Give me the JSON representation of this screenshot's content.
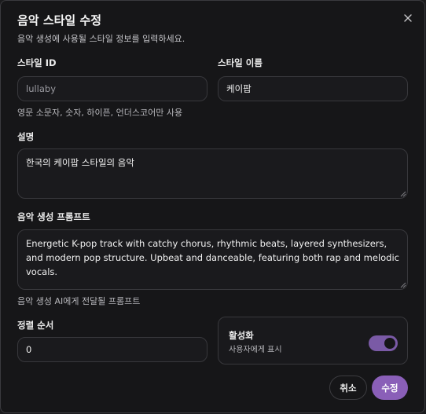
{
  "dialog": {
    "title": "음악 스타일 수정",
    "subtitle": "음악 생성에 사용될 스타일 정보를 입력하세요."
  },
  "style_id": {
    "label": "스타일 ID",
    "placeholder": "lullaby",
    "value": "",
    "hint": "영문 소문자, 숫자, 하이픈, 언더스코어만 사용"
  },
  "style_name": {
    "label": "스타일 이름",
    "value": "케이팝"
  },
  "description": {
    "label": "설명",
    "value": "한국의 케이팝 스타일의 음악"
  },
  "prompt": {
    "label": "음악 생성 프롬프트",
    "value": "Energetic K-pop track with catchy chorus, rhythmic beats, layered synthesizers, and modern pop structure. Upbeat and danceable, featuring both rap and melodic vocals.",
    "hint": "음악 생성 AI에게 전달될 프롬프트"
  },
  "sort_order": {
    "label": "정렬 순서",
    "value": "0"
  },
  "active": {
    "label": "활성화",
    "hint": "사용자에게 표시",
    "on": true,
    "accent_color": "#7a5aa6"
  },
  "buttons": {
    "cancel": "취소",
    "submit": "수정",
    "submit_color": "#8a5fb8"
  },
  "icons": {
    "close": "close-icon",
    "resize": "resize-grip-icon"
  }
}
